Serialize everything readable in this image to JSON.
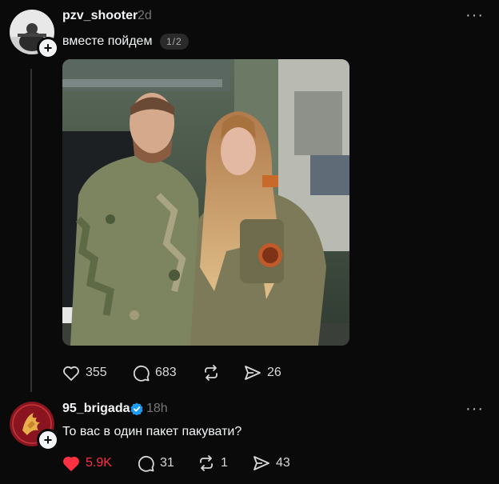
{
  "post": {
    "username": "pzv_shooter",
    "time": "2d",
    "caption": "вместе пойдем",
    "pager": "1/2",
    "likes": "355",
    "comments": "683",
    "shares": "26"
  },
  "reply": {
    "username": "95_brigada",
    "time": "18h",
    "text": "То вас в один пакет пакувати?",
    "likes": "5.9K",
    "comments": "31",
    "reposts": "1",
    "shares": "43"
  },
  "icons": {
    "like": "heart-icon",
    "comment": "comment-bubble-icon",
    "repost": "repost-icon",
    "share": "send-icon",
    "verified": "verified-badge-icon",
    "more": "more-dots-icon"
  },
  "colors": {
    "background": "#0a0a0a",
    "liked": "#ff3040",
    "verified": "#1d9bf0",
    "brigade_logo": "#8a1420"
  }
}
